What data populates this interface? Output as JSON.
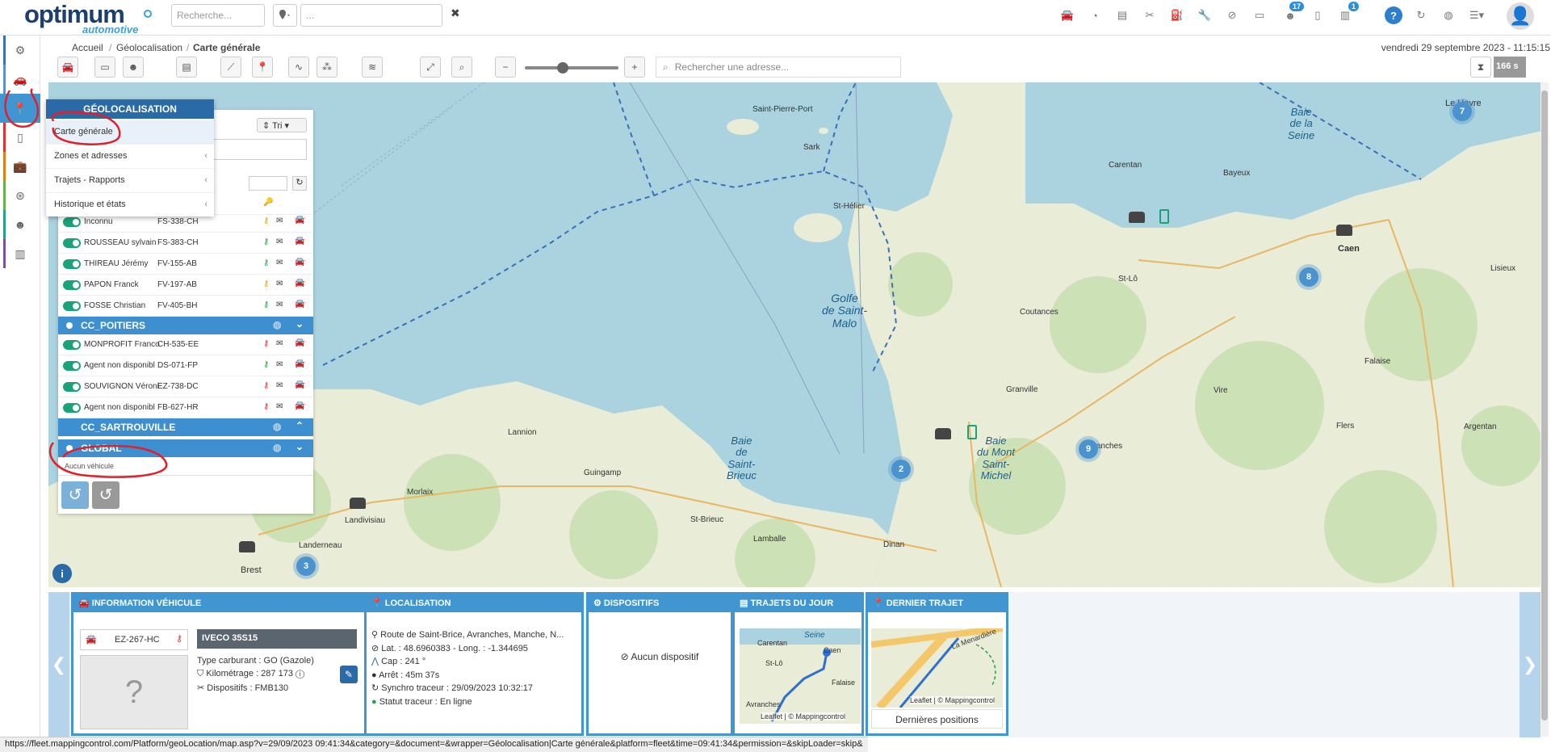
{
  "app": {
    "logo_main": "optimum",
    "logo_sub": "automotive"
  },
  "topbar": {
    "search_placeholder": "Recherche...",
    "search2_placeholder": "...",
    "badges": {
      "notif1": "17",
      "notif2": "1"
    }
  },
  "breadcrumb": {
    "items": [
      "Accueil",
      "Géolocalisation",
      "Carte générale"
    ],
    "datetime": "vendredi 29 septembre 2023 - 11:15:15"
  },
  "toolbar": {
    "address_placeholder": "Rechercher une adresse...",
    "timer": "166 s"
  },
  "geomenu": {
    "title": "GÉOLOCALISATION",
    "items": [
      {
        "label": "Carte générale"
      },
      {
        "label": "Zones et adresses"
      },
      {
        "label": "Trajets - Rapports"
      },
      {
        "label": "Historique et états"
      }
    ]
  },
  "panel": {
    "tri_label": "Tri",
    "vehicles_top": [
      {
        "name": "Inconnu",
        "plate": "FS-338-CH"
      },
      {
        "name": "ROUSSEAU sylvain",
        "plate": "FS-383-CH"
      },
      {
        "name": "THIREAU Jérémy",
        "plate": "FV-155-AB"
      },
      {
        "name": "PAPON Franck",
        "plate": "FV-197-AB"
      },
      {
        "name": "FOSSE Christian",
        "plate": "FV-405-BH"
      }
    ],
    "group_poitiers": "CC_POITIERS",
    "vehicles_poitiers": [
      {
        "name": "MONPROFIT Franco",
        "plate": "CH-535-EE"
      },
      {
        "name": "Agent non disponibl",
        "plate": "DS-071-FP"
      },
      {
        "name": "SOUVIGNON Véroni",
        "plate": "EZ-738-DC"
      },
      {
        "name": "Agent non disponibl",
        "plate": "FB-627-HR"
      }
    ],
    "group_sartrouville": "CC_SARTROUVILLE",
    "group_global": "GLOBAL",
    "no_vehicle": "Aucun véhicule"
  },
  "map": {
    "sea_labels": [
      {
        "text": "Golfe\nde Saint-\nMalo"
      },
      {
        "text": "Baie\nde\nSaint-\nBrieuc"
      },
      {
        "text": "Baie\ndu Mont\nSaint-\nMichel"
      },
      {
        "text": "Baie\nde la\nSeine"
      }
    ],
    "places": [
      "Caen",
      "Le Havre",
      "Saint-Pierre-Port",
      "St-Hélier",
      "Carentan",
      "Bayeux",
      "Granville",
      "Avranches",
      "Brest",
      "Morlaix",
      "Lannion",
      "Guingamp",
      "St-Brieuc",
      "Lamballe",
      "Dinan",
      "Vire",
      "Flers",
      "Argentan",
      "Lisieux",
      "Falaise",
      "St-Lô",
      "Coutances",
      "Landerneau",
      "Landivisiau",
      "Sark"
    ],
    "clusters": [
      "7",
      "8",
      "9",
      "2",
      "3"
    ]
  },
  "vehicle_info": {
    "header": "INFORMATION VÉHICULE",
    "plate": "EZ-267-HC",
    "model": "IVECO 35S15",
    "fuel": "Type carburant : GO (Gazole)",
    "mileage": "Kilométrage : 287 173",
    "devices": "Dispositifs : FMB130"
  },
  "localisation": {
    "header": "LOCALISATION",
    "address": "Route de Saint-Brice, Avranches, Manche, N...",
    "coords": "Lat. : 48.6960383 - Long. : -1.344695",
    "cap": "Cap : 241 °",
    "stop": "Arrêt : 45m 37s",
    "sync": "Synchro traceur : 29/09/2023 10:32:17",
    "status": "Statut traceur : En ligne"
  },
  "dispositifs": {
    "header": "DISPOSITIFS",
    "empty": "Aucun dispositif"
  },
  "trajets": {
    "header": "TRAJETS DU JOUR",
    "attrib": "Leaflet | © Mappingcontrol",
    "places": [
      "Carentan",
      "Caen",
      "St-Lô",
      "Falaise",
      "Avranches",
      "Seine"
    ]
  },
  "dernier": {
    "header": "DERNIER TRAJET",
    "attrib": "Leaflet | © Mappingcontrol",
    "footer": "Dernières positions",
    "street": "La Menardière"
  },
  "statusbar": {
    "url": "https://fleet.mappingcontrol.com/Platform/geoLocation/map.asp?v=29/09/2023 09:41:34&category=&document=&wrapper=Géolocalisation|Carte générale&platform=fleet&time=09:41:34&permission=&skipLoader=skip&"
  },
  "colors": {
    "accent": "#4196d2",
    "sea": "#aad3df",
    "land": "#f2efe9",
    "active_toggle": "#1aa37a",
    "annotation": "#e0202a"
  }
}
